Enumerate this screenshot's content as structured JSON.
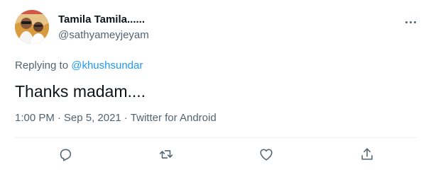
{
  "user": {
    "display_name": "Tamila Tamila......",
    "handle": "@sathyameyjeyam"
  },
  "reply": {
    "prefix": "Replying to",
    "mention": "@khushsundar"
  },
  "tweet": {
    "text": "Thanks madam...."
  },
  "meta": {
    "time": "1:00 PM",
    "date": "Sep 5, 2021",
    "source": "Twitter for Android",
    "separator": "·"
  },
  "icons": {
    "more": "more-options-icon",
    "reply": "reply-icon",
    "retweet": "retweet-icon",
    "like": "like-icon",
    "share": "share-icon"
  },
  "colors": {
    "text": "#0f1419",
    "secondary": "#536471",
    "link": "#1d9bf0",
    "divider": "#eff3f4"
  }
}
